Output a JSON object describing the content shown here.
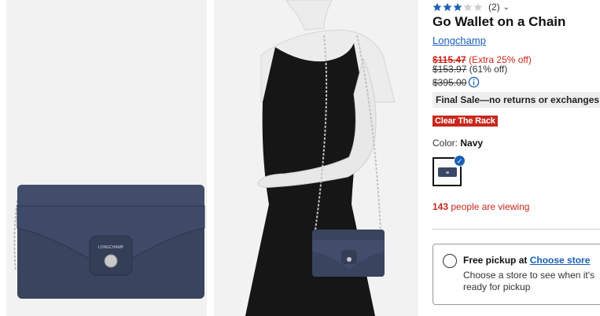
{
  "rating": {
    "stars": 3,
    "max_stars": 5,
    "count_label": "(2)"
  },
  "product": {
    "title": "Go Wallet on a Chain",
    "brand": "Longchamp",
    "sale_price": "$115.47",
    "sale_note": "(Extra 25% off)",
    "compare_price": "$153.97",
    "compare_note": "(61% off)",
    "original_price": "$395.00",
    "final_sale": "Final Sale—no returns or exchanges",
    "badge": "Clear The Rack"
  },
  "color": {
    "label": "Color:",
    "value": "Navy",
    "swatch_color": "#3a4666"
  },
  "viewers": {
    "count": "143",
    "text": "people are viewing"
  },
  "pickup": {
    "title": "Free pickup at",
    "link": "Choose store",
    "note": "Choose a store to see when it's ready for pickup"
  },
  "images": {
    "bag_logo": "LONGCHAMP"
  },
  "colors": {
    "accent": "#1a5fb4",
    "sale": "#c8281c",
    "navy": "#3a4666"
  }
}
